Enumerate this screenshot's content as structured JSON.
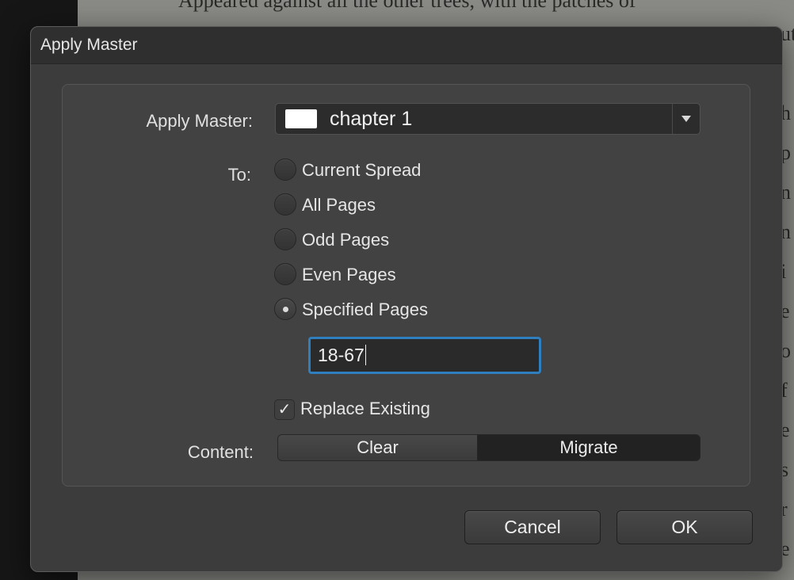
{
  "background_doc": {
    "top_text": "Appeared against all the other trees, with the patches of",
    "edge_glyphs": [
      "ut",
      "",
      "h",
      "p",
      "n",
      "n",
      "i",
      "e",
      "o",
      "f",
      "e",
      "s",
      "r",
      "e"
    ]
  },
  "dialog": {
    "title": "Apply Master",
    "apply_master": {
      "label": "Apply Master:",
      "selected": "chapter 1",
      "swatch_color": "#ffffff"
    },
    "to": {
      "label": "To:",
      "options": [
        {
          "label": "Current Spread",
          "checked": false
        },
        {
          "label": "All Pages",
          "checked": false
        },
        {
          "label": "Odd Pages",
          "checked": false
        },
        {
          "label": "Even Pages",
          "checked": false
        },
        {
          "label": "Specified Pages",
          "checked": true
        }
      ],
      "specified_pages_value": "18-67"
    },
    "replace_existing": {
      "label": "Replace Existing",
      "checked": true,
      "check_glyph": "✓"
    },
    "content": {
      "label": "Content:",
      "options": [
        "Clear",
        "Migrate"
      ],
      "selected": "Migrate"
    },
    "buttons": {
      "cancel": "Cancel",
      "ok": "OK"
    },
    "accent_color": "#2f7fbf"
  }
}
